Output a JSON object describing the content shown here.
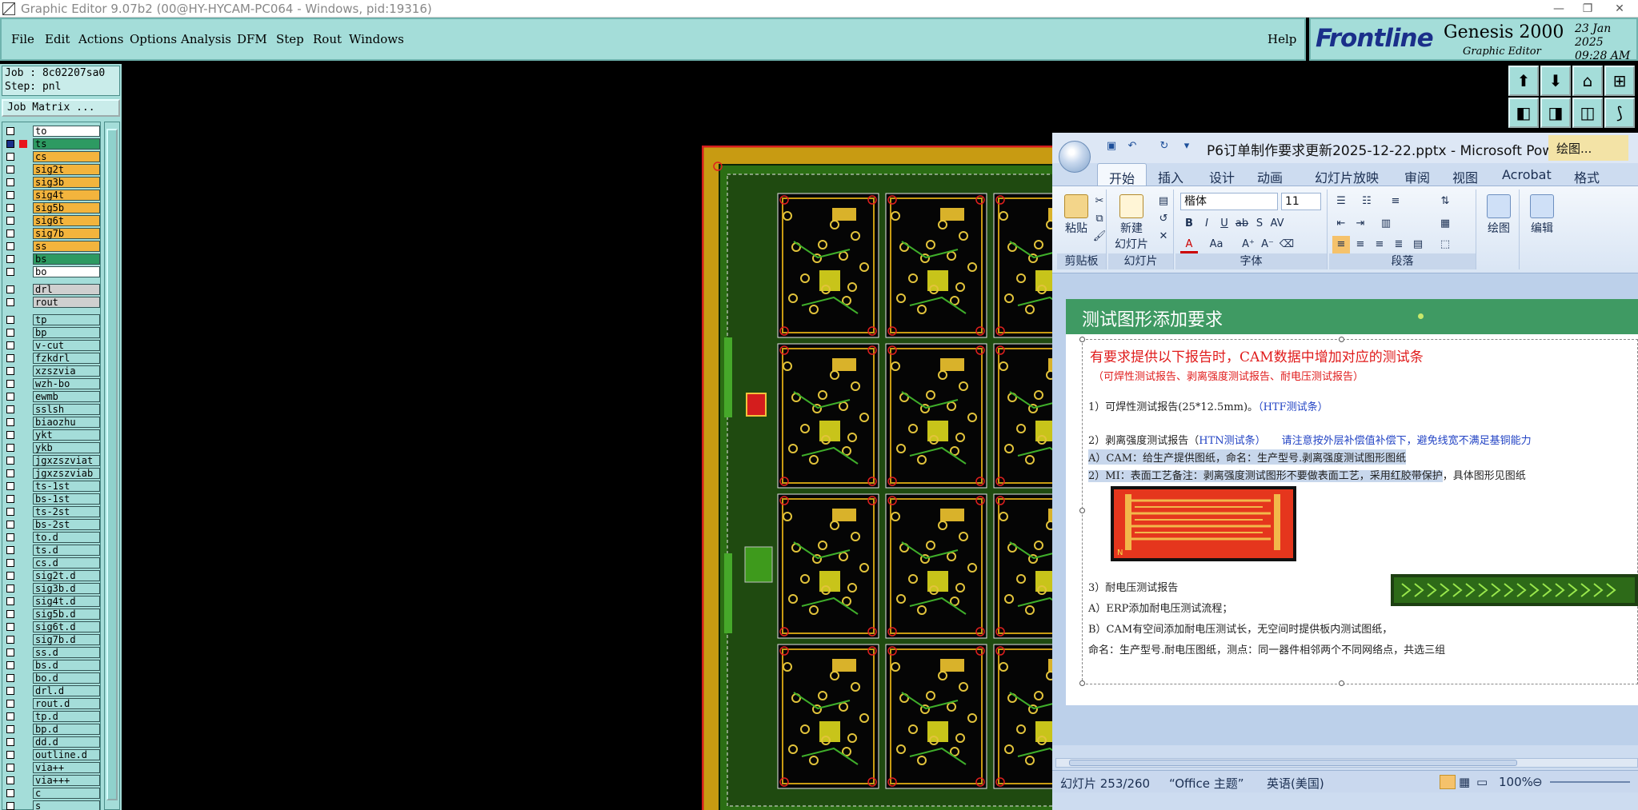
{
  "window": {
    "title": "Graphic Editor 9.07b2 (00@HY-HYCAM-PC064 - Windows, pid:19316)"
  },
  "menu": {
    "file": "File",
    "edit": "Edit",
    "actions": "Actions",
    "options": "Options",
    "analysis": "Analysis",
    "dfm": "DFM",
    "step": "Step",
    "rout": "Rout",
    "windows": "Windows",
    "help": "Help"
  },
  "brand": {
    "logo": "Frontline",
    "product": "Genesis 2000",
    "subtitle": "Graphic Editor",
    "date": "23 Jan 2025",
    "time": "09:28 AM"
  },
  "job": {
    "job_line": "Job : 8c02207sa0",
    "step_line": "Step: pnl",
    "matrix_button": "Job Matrix ..."
  },
  "layers": [
    {
      "name": "to",
      "color": "#ffffff",
      "bg": "#ffffff",
      "checked": false
    },
    {
      "name": "ts",
      "color": "#e8141c",
      "bg": "#2d9a62",
      "checked": true
    },
    {
      "name": "cs",
      "color": "#ffffff",
      "bg": "#f3b43d",
      "checked": false
    },
    {
      "name": "sig2t",
      "color": "#ffffff",
      "bg": "#f3b43d",
      "checked": false
    },
    {
      "name": "sig3b",
      "color": "#ffffff",
      "bg": "#f3b43d",
      "checked": false
    },
    {
      "name": "sig4t",
      "color": "#ffffff",
      "bg": "#f3b43d",
      "checked": false
    },
    {
      "name": "sig5b",
      "color": "#ffffff",
      "bg": "#f3b43d",
      "checked": false
    },
    {
      "name": "sig6t",
      "color": "#ffffff",
      "bg": "#f3b43d",
      "checked": false
    },
    {
      "name": "sig7b",
      "color": "#ffffff",
      "bg": "#f3b43d",
      "checked": false
    },
    {
      "name": "ss",
      "color": "#ffffff",
      "bg": "#f3b43d",
      "checked": false
    },
    {
      "name": "bs",
      "color": "#ffffff",
      "bg": "#2d9a62",
      "checked": false
    },
    {
      "name": "bo",
      "color": "#ffffff",
      "bg": "#ffffff",
      "checked": false
    },
    {
      "name": "drl",
      "color": "#ffffff",
      "bg": "#cfcfcf",
      "checked": false
    },
    {
      "name": "rout",
      "color": "#ffffff",
      "bg": "#cfcfcf",
      "checked": false
    },
    {
      "name": "tp",
      "color": "#ffffff",
      "bg": "#a4ddd9",
      "checked": false
    },
    {
      "name": "bp",
      "color": "#ffffff",
      "bg": "#a4ddd9",
      "checked": false
    },
    {
      "name": "v-cut",
      "color": "#ffffff",
      "bg": "#a4ddd9",
      "checked": false
    },
    {
      "name": "fzkdrl",
      "color": "#ffffff",
      "bg": "#a4ddd9",
      "checked": false
    },
    {
      "name": "xzszvia",
      "color": "#ffffff",
      "bg": "#a4ddd9",
      "checked": false
    },
    {
      "name": "wzh-bo",
      "color": "#ffffff",
      "bg": "#a4ddd9",
      "checked": false
    },
    {
      "name": "ewmb",
      "color": "#ffffff",
      "bg": "#a4ddd9",
      "checked": false
    },
    {
      "name": "sslsh",
      "color": "#ffffff",
      "bg": "#a4ddd9",
      "checked": false
    },
    {
      "name": "biaozhu",
      "color": "#ffffff",
      "bg": "#a4ddd9",
      "checked": false
    },
    {
      "name": "ykt",
      "color": "#ffffff",
      "bg": "#a4ddd9",
      "checked": false
    },
    {
      "name": "ykb",
      "color": "#ffffff",
      "bg": "#a4ddd9",
      "checked": false
    },
    {
      "name": "jgxzszviat",
      "color": "#ffffff",
      "bg": "#a4ddd9",
      "checked": false
    },
    {
      "name": "jgxzszviab",
      "color": "#ffffff",
      "bg": "#a4ddd9",
      "checked": false
    },
    {
      "name": "ts-1st",
      "color": "#ffffff",
      "bg": "#a4ddd9",
      "checked": false
    },
    {
      "name": "bs-1st",
      "color": "#ffffff",
      "bg": "#a4ddd9",
      "checked": false
    },
    {
      "name": "ts-2st",
      "color": "#ffffff",
      "bg": "#a4ddd9",
      "checked": false
    },
    {
      "name": "bs-2st",
      "color": "#ffffff",
      "bg": "#a4ddd9",
      "checked": false
    },
    {
      "name": "to.d",
      "color": "#ffffff",
      "bg": "#a4ddd9",
      "checked": false
    },
    {
      "name": "ts.d",
      "color": "#ffffff",
      "bg": "#a4ddd9",
      "checked": false
    },
    {
      "name": "cs.d",
      "color": "#ffffff",
      "bg": "#a4ddd9",
      "checked": false
    },
    {
      "name": "sig2t.d",
      "color": "#ffffff",
      "bg": "#a4ddd9",
      "checked": false
    },
    {
      "name": "sig3b.d",
      "color": "#ffffff",
      "bg": "#a4ddd9",
      "checked": false
    },
    {
      "name": "sig4t.d",
      "color": "#ffffff",
      "bg": "#a4ddd9",
      "checked": false
    },
    {
      "name": "sig5b.d",
      "color": "#ffffff",
      "bg": "#a4ddd9",
      "checked": false
    },
    {
      "name": "sig6t.d",
      "color": "#ffffff",
      "bg": "#a4ddd9",
      "checked": false
    },
    {
      "name": "sig7b.d",
      "color": "#ffffff",
      "bg": "#a4ddd9",
      "checked": false
    },
    {
      "name": "ss.d",
      "color": "#ffffff",
      "bg": "#a4ddd9",
      "checked": false
    },
    {
      "name": "bs.d",
      "color": "#ffffff",
      "bg": "#a4ddd9",
      "checked": false
    },
    {
      "name": "bo.d",
      "color": "#ffffff",
      "bg": "#a4ddd9",
      "checked": false
    },
    {
      "name": "drl.d",
      "color": "#ffffff",
      "bg": "#a4ddd9",
      "checked": false
    },
    {
      "name": "rout.d",
      "color": "#ffffff",
      "bg": "#a4ddd9",
      "checked": false
    },
    {
      "name": "tp.d",
      "color": "#ffffff",
      "bg": "#a4ddd9",
      "checked": false
    },
    {
      "name": "bp.d",
      "color": "#ffffff",
      "bg": "#a4ddd9",
      "checked": false
    },
    {
      "name": "dd.d",
      "color": "#ffffff",
      "bg": "#a4ddd9",
      "checked": false
    },
    {
      "name": "outline.d",
      "color": "#ffffff",
      "bg": "#a4ddd9",
      "checked": false
    },
    {
      "name": "via++",
      "color": "#ffffff",
      "bg": "#a4ddd9",
      "checked": false
    },
    {
      "name": "via+++",
      "color": "#ffffff",
      "bg": "#a4ddd9",
      "checked": false
    },
    {
      "name": "c",
      "color": "#ffffff",
      "bg": "#a4ddd9",
      "checked": false
    },
    {
      "name": "s",
      "color": "#ffffff",
      "bg": "#a4ddd9",
      "checked": false
    }
  ],
  "colors": {
    "panel": "#a4ddd9",
    "board_copper": "#c89b12",
    "board_mask": "#2b6e14",
    "board_outline": "#d41d1d"
  },
  "ppt": {
    "title": "P6订单制作要求更新2025-12-22.pptx - Microsoft Power...",
    "context_tab": "绘图...",
    "tabs": [
      "开始",
      "插入",
      "设计",
      "动画",
      "幻灯片放映",
      "审阅",
      "视图",
      "Acrobat",
      "格式"
    ],
    "ribbon": {
      "paste": "粘贴",
      "new_slide": "新建\n幻灯片",
      "new_slide_1": "新建",
      "new_slide_2": "幻灯片",
      "font_name": "楷体",
      "font_size": "11",
      "draw": "绘图",
      "edit": "编辑",
      "groups": [
        "剪贴板",
        "幻灯片",
        "字体",
        "段落"
      ]
    },
    "slide": {
      "title": "测试图形添加要求",
      "line1": "有要求提供以下报告时，CAM数据中增加对应的测试条",
      "line2": "（可焊性测试报告、剥离强度测试报告、耐电压测试报告）",
      "line3a": "1）可焊性测试报告(25*12.5mm)。",
      "line3b": "（HTF测试条）",
      "line4a": "2）剥离强度测试报告（",
      "line4b": "HTN测试条）",
      "line4c": "请注意按外层补偿值补偿下，避免线宽不满足基铜能力",
      "line5": "A）CAM：给生产提供图纸，命名：生产型号.剥离强度测试图形图纸",
      "line6a": "2）MI：表面工艺备注：剥离强度测试图形不要做表面工艺，采用红胶带保护",
      "line6b": "，具体图形见图纸",
      "line7": "3）耐电压测试报告",
      "line8": "A）ERP添加耐电压测试流程；",
      "line9": "B）CAM有空间添加耐电压测试长，无空间时提供板内测试图纸，",
      "line10": "命名：生产型号.耐电压图纸，测点：同一器件相邻两个不同网络点，共选三组",
      "coupon_label": "N"
    },
    "status": {
      "slide": "幻灯片 253/260",
      "theme": "“Office 主题”",
      "lang": "英语(美国)",
      "zoom": "100%"
    }
  }
}
